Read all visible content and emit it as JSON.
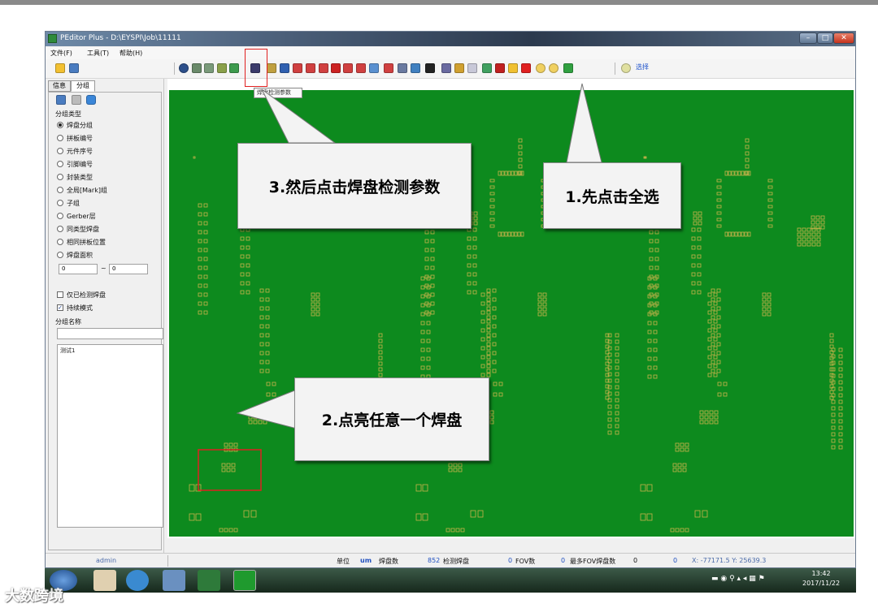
{
  "window": {
    "title": "PEditor Plus - D:\\EYSPI\\Job\\11111",
    "minimize": "–",
    "maximize": "□",
    "close": "✕"
  },
  "menu": {
    "file": "文件(F)",
    "tools": "工具(T)",
    "help": "帮助(H)"
  },
  "toolbar": {
    "tooltip": "焊盘检测参数",
    "select_all_label": "选择"
  },
  "left_panel": {
    "tabs": [
      "信息",
      "分组"
    ],
    "group_type_label": "分组类型",
    "group_options": [
      "焊盘分组",
      "拼板编号",
      "元件序号",
      "引脚编号",
      "封装类型",
      "全局[Mark]组",
      "子组",
      "Gerber层",
      "同类型焊盘",
      "相同拼板位置",
      "焊盘面积"
    ],
    "selected_option": "焊盘分组",
    "area_min": "0",
    "range_sep": "~",
    "area_max": "0",
    "only_detected_pads": "仅已检测焊盘",
    "continuous_mode": "持续模式",
    "group_name_label": "分组名称",
    "group_list": [
      "测试1"
    ]
  },
  "callouts": {
    "step1": "1.先点击全选",
    "step2": "2.点亮任意一个焊盘",
    "step3": "3.然后点击焊盘检测参数"
  },
  "status": {
    "user": "admin",
    "unit_label": "单位",
    "unit_value": "um",
    "pad_count_label": "焊盘数",
    "pad_count": "852",
    "detected_pads_label": "检测焊盘",
    "detected_pads": "0",
    "fov_label": "FOV数",
    "fov_count": "0",
    "max_fov_pads_label": "最多FOV焊盘数",
    "max_fov_pads": "0",
    "extra_value": "0",
    "coords": "X: -77171.5  Y: 25639.3"
  },
  "taskbar": {
    "time": "13:42",
    "date": "2017/11/22"
  },
  "watermark": "大数跨境",
  "colors": {
    "board": "#0d8a1e",
    "pad_outline": "#c9b24a",
    "highlight": "#e02020"
  }
}
